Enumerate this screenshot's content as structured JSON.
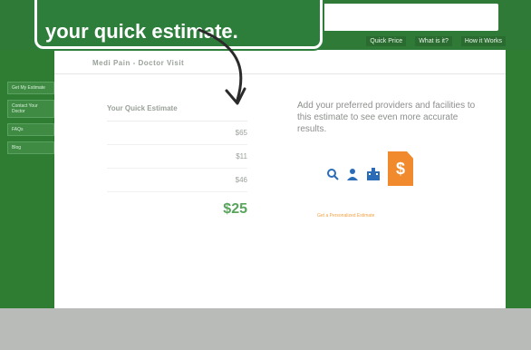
{
  "callout": {
    "text": "your quick estimate."
  },
  "header": {
    "title": ""
  },
  "nav": [
    "Quick Price",
    "What is it?",
    "How it Works"
  ],
  "left_menu": [
    "Get My Estimate",
    "Contact Your Doctor",
    "FAQs",
    "Blog"
  ],
  "page": {
    "title": "Medi Pain - Doctor Visit"
  },
  "estimate": {
    "title": "Your Quick Estimate",
    "description": "",
    "link": "",
    "head_left": "",
    "head_right": "",
    "rows": [
      {
        "label": "",
        "amount": "$65",
        "sub": ""
      },
      {
        "label": "",
        "amount": "$11",
        "sub": ""
      },
      {
        "label": "",
        "amount": "$46",
        "sub": ""
      }
    ],
    "total": {
      "label": "",
      "amount": "$25"
    }
  },
  "right": {
    "text": "Add your preferred providers and facilities to this estimate to see even more accurate results.",
    "icons": [
      {
        "name": "search-icon",
        "caption": ""
      },
      {
        "name": "doctor-icon",
        "caption": ""
      },
      {
        "name": "facility-icon",
        "caption": ""
      }
    ],
    "dollar_symbol": "$",
    "note": "",
    "link": "Get a Personalized Estimate"
  },
  "colors": {
    "brand_green": "#2f7a36",
    "total_green": "#58a55b",
    "accent_orange": "#f08a2c"
  }
}
